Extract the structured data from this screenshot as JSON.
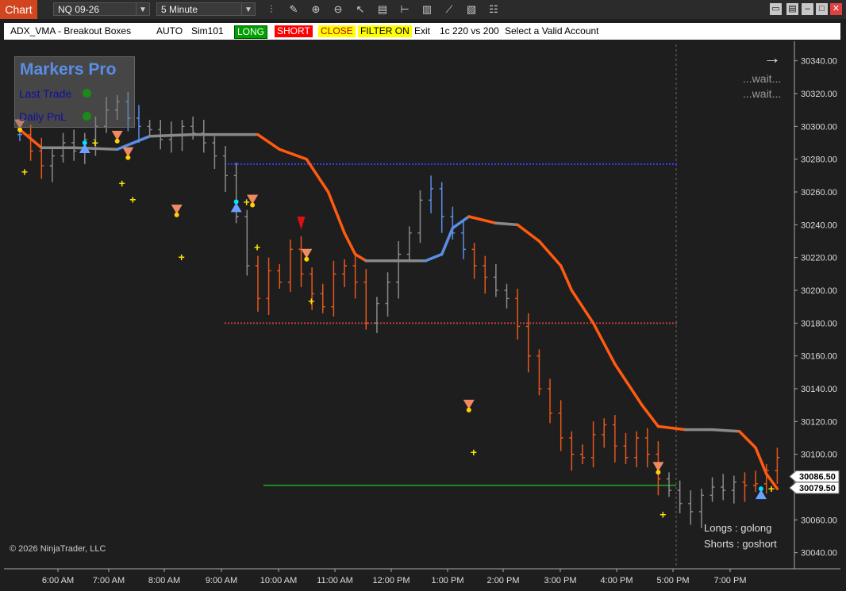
{
  "toolbar": {
    "tab": "Chart",
    "instrument": "NQ 09-26",
    "interval": "5 Minute"
  },
  "status": {
    "indicator": "ADX_VMA - Breakout Boxes",
    "mode": "AUTO",
    "account": "Sim101",
    "long": "LONG",
    "short": "SHORT",
    "close": "CLOSE",
    "filter": "FILTER ON",
    "exit": "Exit",
    "size": "1c 220 vs 200",
    "account_msg": "Select a Valid Account",
    "colors": {
      "long": "#00a000",
      "short": "#ff0000",
      "close": "#ffff00",
      "filter": "#ffff00"
    }
  },
  "panel": {
    "title": "Markers Pro",
    "last_trade": "Last Trade",
    "daily_pnl": "Daily PnL"
  },
  "overlay": {
    "wait1": "...wait...",
    "wait2": "...wait...",
    "longs": "Longs : golong",
    "shorts": "Shorts : goshort",
    "copyright": "© 2026 NinjaTrader, LLC"
  },
  "chart_data": {
    "type": "line",
    "title": "",
    "x_ticks": [
      "6:00 AM",
      "7:00 AM",
      "8:00 AM",
      "9:00 AM",
      "10:00 AM",
      "11:00 AM",
      "12:00 PM",
      "1:00 PM",
      "2:00 PM",
      "3:00 PM",
      "4:00 PM",
      "5:00 PM",
      "7:00 PM"
    ],
    "y_ticks": [
      "30340.00",
      "30320.00",
      "30300.00",
      "30280.00",
      "30260.00",
      "30240.00",
      "30220.00",
      "30200.00",
      "30180.00",
      "30160.00",
      "30140.00",
      "30120.00",
      "30100.00",
      "30080.00",
      "30060.00",
      "30040.00"
    ],
    "ylim": [
      30035,
      30350
    ],
    "price_labels": [
      "30086.50",
      "30079.50"
    ],
    "levels": [
      {
        "name": "breakout-high",
        "value": 30277,
        "color": "#3b3bff"
      },
      {
        "name": "breakout-low",
        "value": 30180,
        "color": "#c04040"
      },
      {
        "name": "support",
        "value": 30081,
        "color": "#1e8c1e"
      }
    ],
    "series": [
      {
        "name": "ADX_VMA",
        "x": [
          0,
          4,
          10,
          18,
          24,
          32,
          44,
          48,
          53,
          57,
          60,
          62,
          64,
          66,
          70,
          75,
          78,
          80,
          83,
          88,
          92,
          96,
          100,
          102,
          106,
          110,
          115,
          118,
          123,
          128,
          133,
          136,
          138,
          140
        ],
        "y": [
          30298,
          30287,
          30287,
          30286,
          30294,
          30295,
          30295,
          30286,
          30280,
          30260,
          30235,
          30222,
          30218,
          30218,
          30218,
          30218,
          30222,
          30238,
          30245,
          30241,
          30240,
          30230,
          30215,
          30200,
          30180,
          30155,
          30130,
          30117,
          30115,
          30115,
          30114,
          30104,
          30088,
          30079
        ]
      },
      {
        "name": "bars",
        "x": [
          0,
          2,
          4,
          6,
          8,
          10,
          12,
          14,
          16,
          18,
          20,
          22,
          24,
          26,
          28,
          30,
          32,
          34,
          36,
          38,
          40,
          42,
          44,
          46,
          48,
          50,
          52,
          54,
          56,
          58,
          60,
          62,
          64,
          66,
          68,
          70,
          72,
          74,
          76,
          78,
          80,
          82,
          84,
          86,
          88,
          90,
          92,
          94,
          96,
          98,
          100,
          102,
          104,
          106,
          108,
          110,
          112,
          114,
          116,
          118,
          120,
          122,
          124,
          126,
          128,
          130,
          132,
          134,
          136,
          138,
          140
        ],
        "y": [
          30295,
          30285,
          30276,
          30282,
          30290,
          30285,
          30292,
          30300,
          30310,
          30315,
          30305,
          30300,
          30298,
          30292,
          30295,
          30300,
          30296,
          30290,
          30282,
          30270,
          30245,
          30215,
          30195,
          30212,
          30205,
          30225,
          30210,
          30198,
          30190,
          30210,
          30215,
          30205,
          30180,
          30192,
          30205,
          30222,
          30235,
          30255,
          30262,
          30245,
          30235,
          30225,
          30215,
          30208,
          30200,
          30195,
          30178,
          30160,
          30140,
          30125,
          30110,
          30100,
          30098,
          30112,
          30118,
          30105,
          30098,
          30110,
          30100,
          30085,
          30078,
          30070,
          30065,
          30075,
          30080,
          30078,
          30083,
          30081,
          30082,
          30090,
          30098
        ]
      }
    ],
    "signals": [
      {
        "type": "short",
        "x": 0,
        "y": 30298
      },
      {
        "type": "long",
        "x": 12,
        "y": 30290
      },
      {
        "type": "short",
        "x": 18,
        "y": 30291
      },
      {
        "type": "short",
        "x": 20,
        "y": 30281
      },
      {
        "type": "short",
        "x": 29,
        "y": 30246
      },
      {
        "type": "long",
        "x": 40,
        "y": 30254
      },
      {
        "type": "short",
        "x": 43,
        "y": 30252
      },
      {
        "type": "short",
        "x": 53,
        "y": 30219
      },
      {
        "type": "short",
        "x": 83,
        "y": 30127
      },
      {
        "type": "short",
        "x": 118,
        "y": 30089
      },
      {
        "type": "long",
        "x": 137,
        "y": 30079
      }
    ]
  }
}
